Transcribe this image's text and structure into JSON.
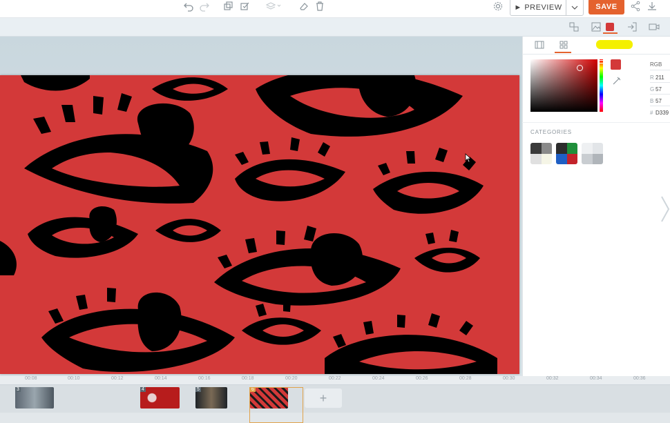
{
  "toolbar": {
    "icons": [
      "undo-icon",
      "redo-icon",
      "duplicate-icon",
      "copy-style-icon",
      "layers-icon",
      "eraser-icon",
      "delete-icon",
      "settings-icon",
      "share-icon",
      "download-icon"
    ],
    "preview_label": "► PREVIEW",
    "save_label": "SAVE"
  },
  "subbar": {
    "icons": [
      "replace-icon",
      "image-icon",
      "color-icon",
      "exit-icon",
      "video-icon"
    ],
    "selected_color": "#d33939"
  },
  "panel": {
    "tabs": [
      "film-icon",
      "grid-icon"
    ],
    "color_mode": "RGB",
    "r_label": "R",
    "r_value": "211",
    "g_label": "G",
    "g_value": "57",
    "b_label": "B",
    "b_value": "57",
    "hex_label": "#",
    "hex_value": "D339",
    "categories_label": "CATEGORIES",
    "categories": [
      {
        "name": "dark-grey",
        "colors": [
          "#3a3a3a",
          "#8a8a8a",
          "#e0e0e0",
          "#f5f5e6"
        ]
      },
      {
        "name": "primary",
        "colors": [
          "#2c2c2c",
          "#1f8f3a",
          "#1f5fc4",
          "#c3232b"
        ]
      },
      {
        "name": "light-grey",
        "colors": [
          "#eef0f2",
          "#e2e5e8",
          "#c9cdd1",
          "#b0b5ba"
        ]
      }
    ]
  },
  "canvas": {
    "background": "#d33939",
    "pattern": "eyes"
  },
  "timeline": {
    "ticks": [
      "00:08",
      "00:10",
      "00:12",
      "00:14",
      "00:16",
      "00:18",
      "00:20",
      "00:22",
      "00:24",
      "00:26",
      "00:28",
      "00:30",
      "00:32",
      "00:34",
      "00:36"
    ],
    "clips": [
      {
        "number": "3"
      },
      {
        "number": "4"
      },
      {
        "number": "5"
      },
      {
        "number": "6"
      }
    ],
    "add_label": "+"
  }
}
